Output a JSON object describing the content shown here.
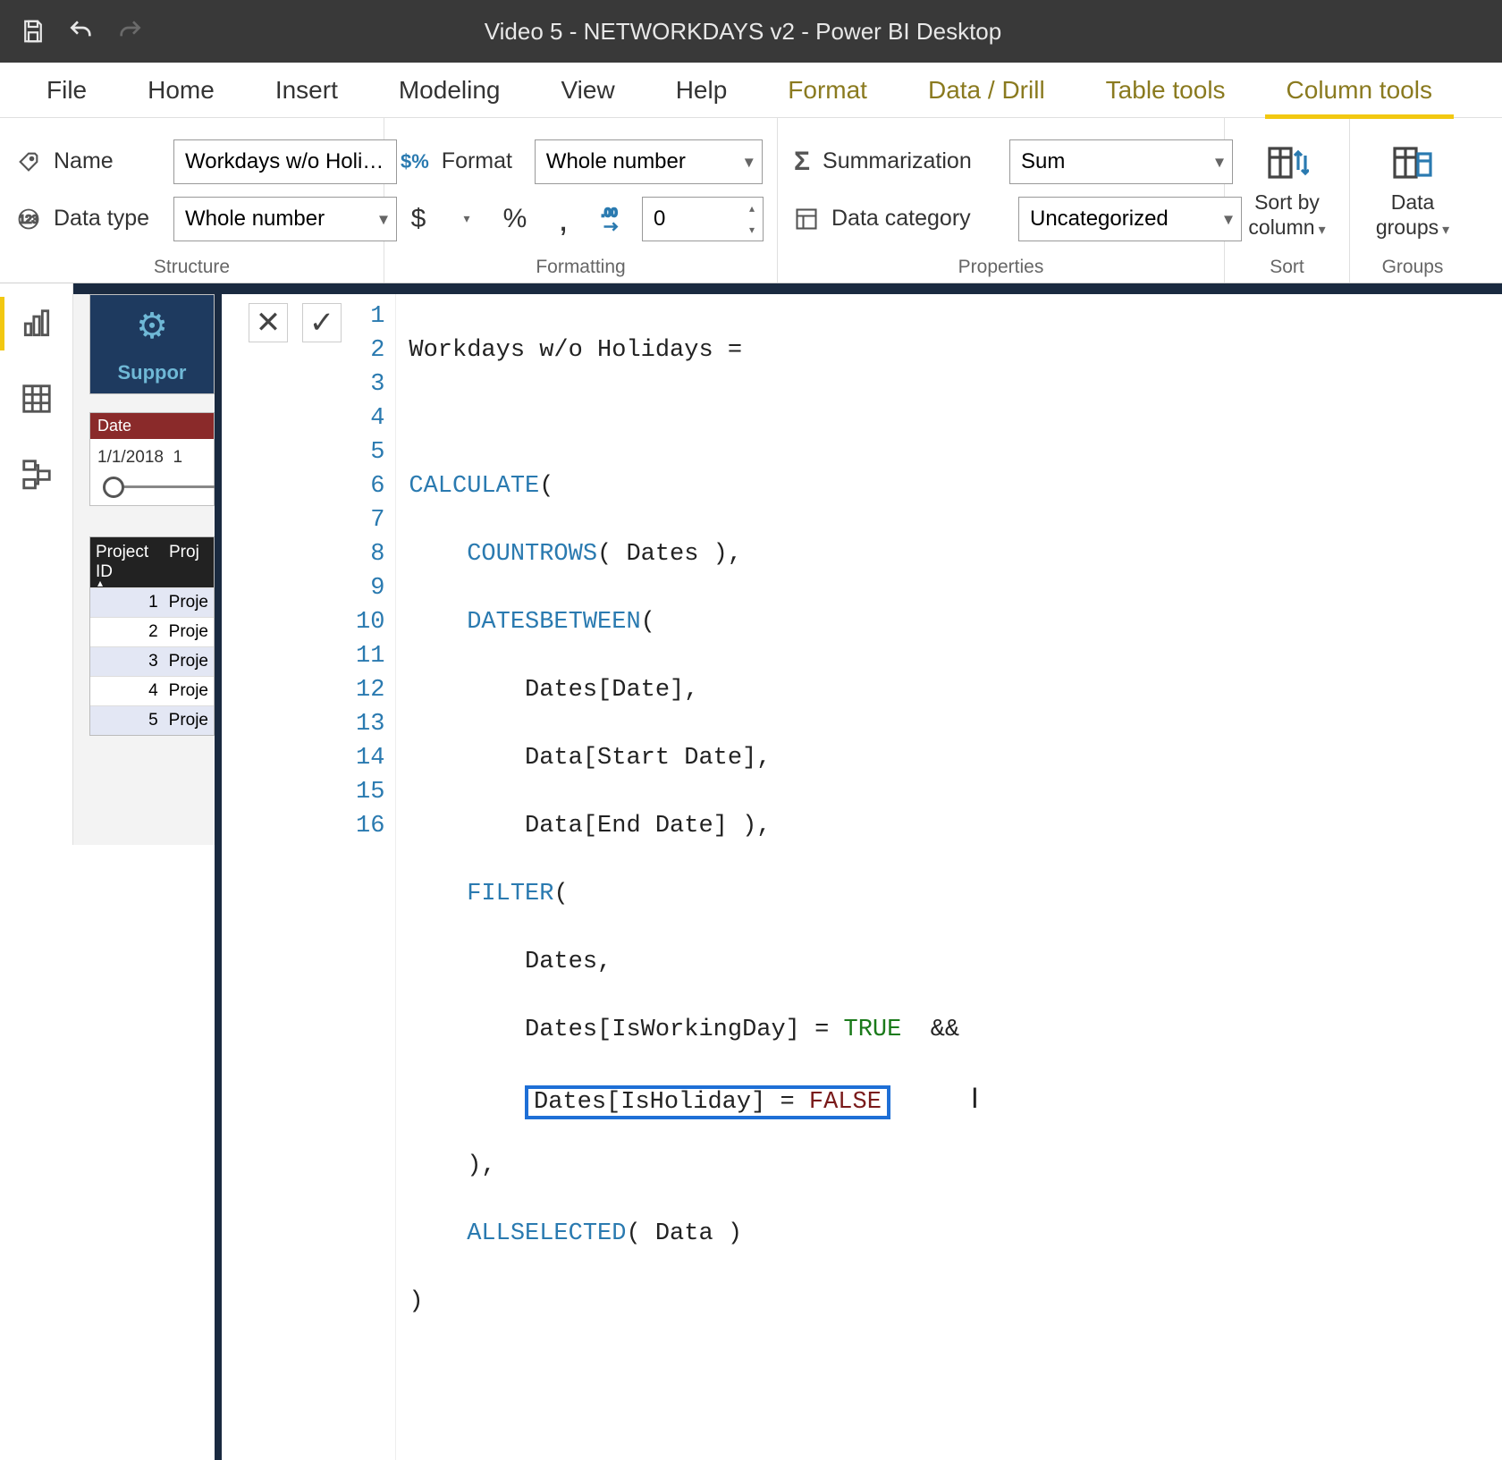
{
  "titlebar": {
    "title": "Video 5 - NETWORKDAYS v2 - Power BI Desktop"
  },
  "tabs": {
    "file": "File",
    "home": "Home",
    "insert": "Insert",
    "modeling": "Modeling",
    "view": "View",
    "help": "Help",
    "format": "Format",
    "datadrill": "Data / Drill",
    "tabletools": "Table tools",
    "columntools": "Column tools"
  },
  "ribbon": {
    "structure": {
      "label": "Structure",
      "name_label": "Name",
      "name_value": "Workdays w/o Holi…",
      "datatype_label": "Data type",
      "datatype_value": "Whole number"
    },
    "formatting": {
      "label": "Formatting",
      "format_label": "Format",
      "format_value": "Whole number",
      "currency": "$",
      "percent": "%",
      "comma": ",",
      "decimals_value": "0"
    },
    "properties": {
      "label": "Properties",
      "sum_label": "Summarization",
      "sum_value": "Sum",
      "cat_label": "Data category",
      "cat_value": "Uncategorized"
    },
    "sort": {
      "label": "Sort",
      "btn": "Sort by\ncolumn"
    },
    "groups": {
      "label": "Groups",
      "btn": "Data\ngroups"
    }
  },
  "sidevis": {
    "support": "Suppor",
    "slicer_header": "Date",
    "slicer_start": "1/1/2018",
    "table_hdr1": "Project ID",
    "table_hdr2": "Proj",
    "rows": [
      {
        "id": "1",
        "name": "Proje"
      },
      {
        "id": "2",
        "name": "Proje"
      },
      {
        "id": "3",
        "name": "Proje"
      },
      {
        "id": "4",
        "name": "Proje"
      },
      {
        "id": "5",
        "name": "Proje"
      }
    ]
  },
  "formula": {
    "lines": [
      "Workdays w/o Holidays =",
      "",
      "CALCULATE(",
      "    COUNTROWS( Dates ),",
      "    DATESBETWEEN(",
      "        Dates[Date],",
      "        Data[Start Date],",
      "        Data[End Date] ),",
      "    FILTER(",
      "        Dates,",
      "        Dates[IsWorkingDay] = TRUE  &&",
      "        Dates[IsHoliday] = FALSE",
      "    ),",
      "    ALLSELECTED( Data )",
      ")",
      ""
    ],
    "gutter": [
      "1",
      "2",
      "3",
      "4",
      "5",
      "6",
      "7",
      "8",
      "9",
      "10",
      "11",
      "12",
      "13",
      "14",
      "15",
      "16"
    ]
  }
}
